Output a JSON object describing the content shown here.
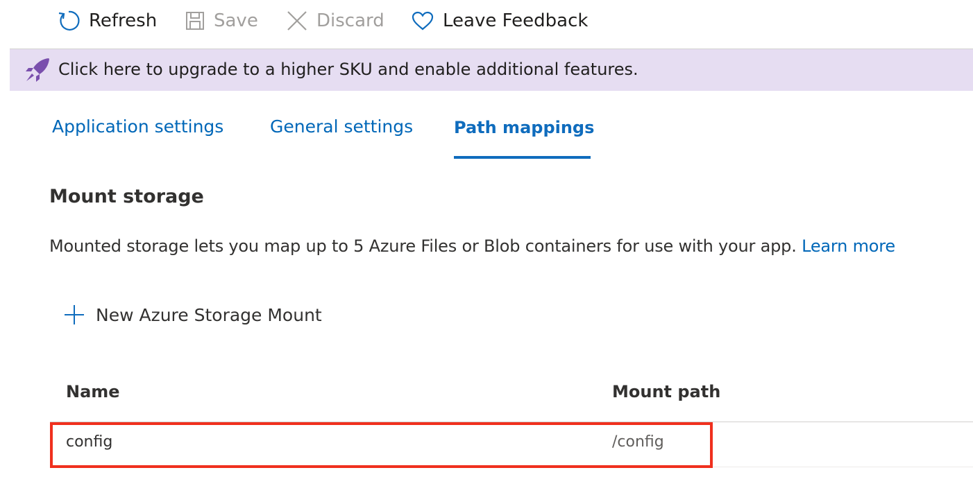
{
  "toolbar": {
    "refresh_label": "Refresh",
    "save_label": "Save",
    "discard_label": "Discard",
    "feedback_label": "Leave Feedback"
  },
  "banner": {
    "text": "Click here to upgrade to a higher SKU and enable additional features.",
    "icon": "rocket-icon",
    "background_color": "#e6ddf2",
    "icon_color": "#7a4fad"
  },
  "tabs": [
    {
      "label": "Application settings",
      "selected": false
    },
    {
      "label": "General settings",
      "selected": false
    },
    {
      "label": "Path mappings",
      "selected": true
    }
  ],
  "section": {
    "title": "Mount storage",
    "description": "Mounted storage lets you map up to 5 Azure Files or Blob containers for use with your app.",
    "learn_more_label": "Learn more"
  },
  "new_mount_label": "New Azure Storage Mount",
  "table": {
    "columns": [
      "Name",
      "Mount path"
    ],
    "rows": [
      {
        "name": "config",
        "mount_path": "/config"
      }
    ]
  },
  "colors": {
    "accent": "#0f6cbd",
    "link": "#0067b8",
    "highlight": "#f0301e",
    "disabled": "#a19f9d"
  }
}
